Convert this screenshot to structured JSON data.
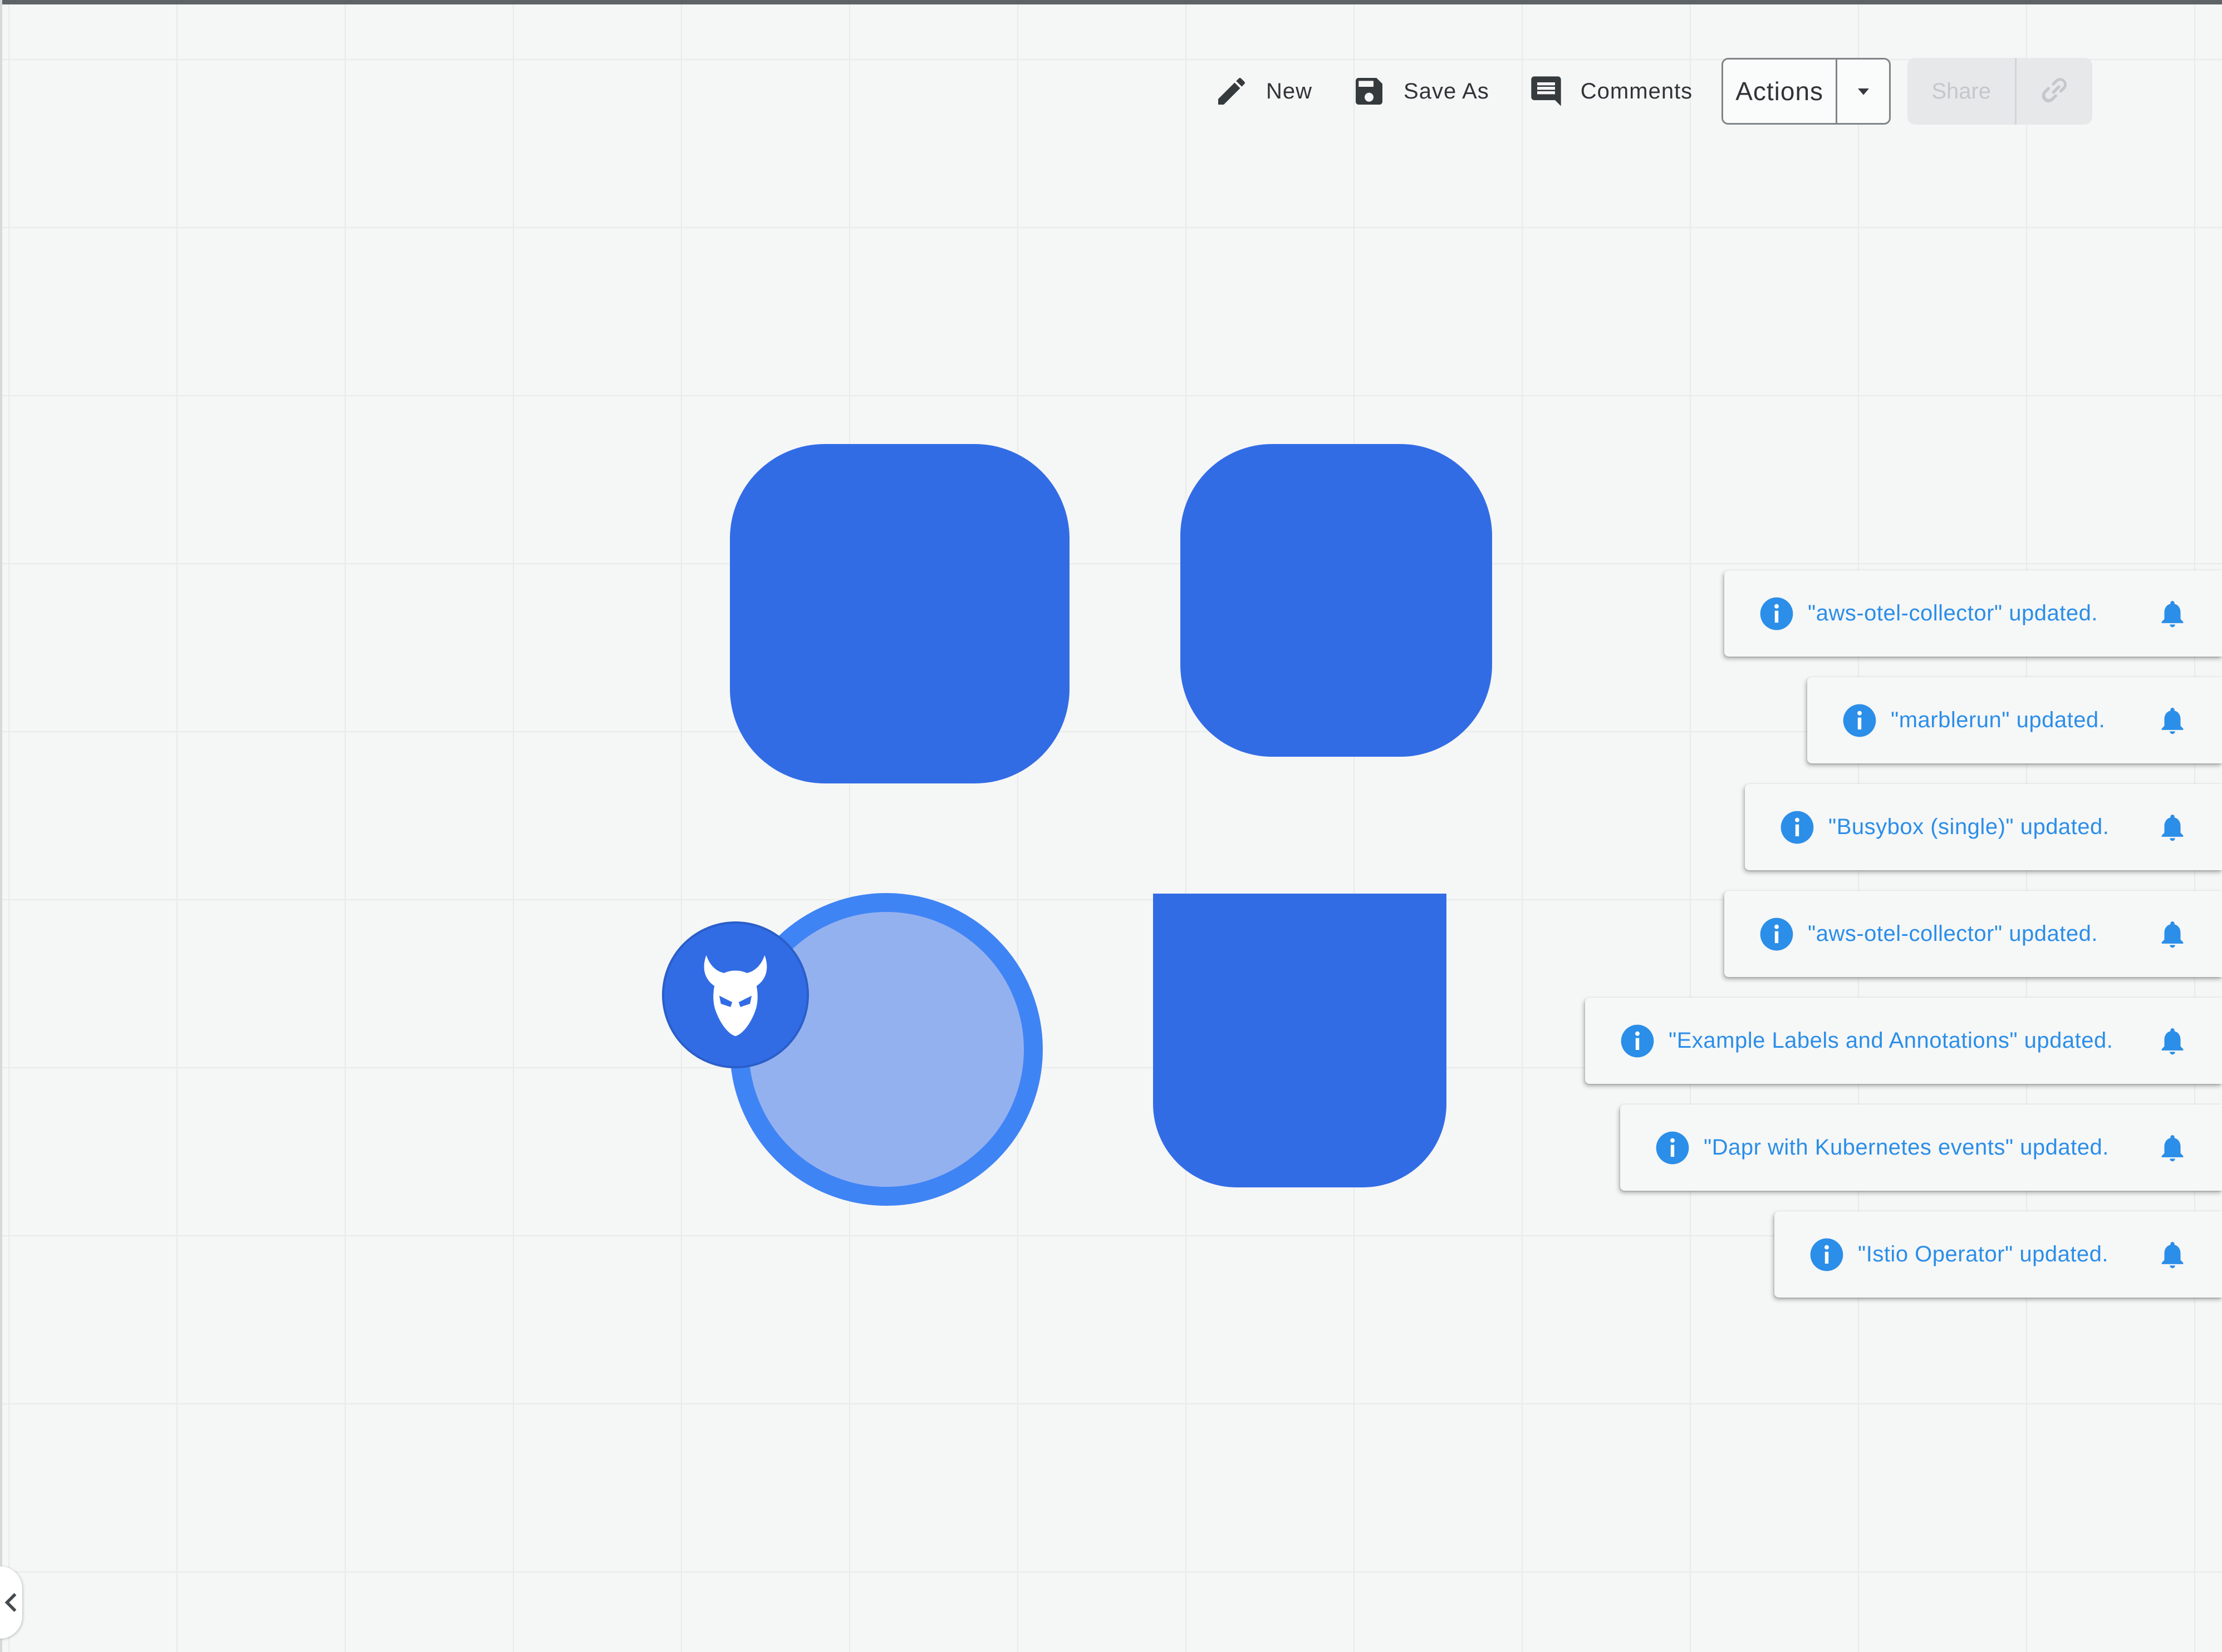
{
  "toolbar": {
    "new_label": "New",
    "save_as_label": "Save As",
    "comments_label": "Comments",
    "actions_label": "Actions",
    "share_label": "Share",
    "icons": [
      "pencil-icon",
      "save-icon",
      "comment-icon",
      "caret-down-icon",
      "link-icon"
    ]
  },
  "canvas": {
    "nodes": [
      {
        "shape": "rounded-square",
        "color": "#326ce5"
      },
      {
        "shape": "rounded-square",
        "color": "#326ce5"
      },
      {
        "shape": "circle",
        "color": "#94b1ef",
        "border_color": "#3f84f5",
        "badge_icon": "devil-mask-icon"
      },
      {
        "shape": "rounded-bottom-square",
        "color": "#326ce5"
      }
    ]
  },
  "notifications": [
    {
      "message": "\"aws-otel-collector\" updated."
    },
    {
      "message": "\"marblerun\" updated."
    },
    {
      "message": "\"Busybox (single)\" updated."
    },
    {
      "message": "\"aws-otel-collector\" updated."
    },
    {
      "message": "\"Example Labels and Annotations\" updated."
    },
    {
      "message": "\"Dapr with Kubernetes events\" updated."
    },
    {
      "message": "\"Istio Operator\" updated."
    }
  ],
  "colors": {
    "accent": "#326ce5",
    "notification_text": "#2b8ee8",
    "canvas_background": "#f5f6f6"
  }
}
